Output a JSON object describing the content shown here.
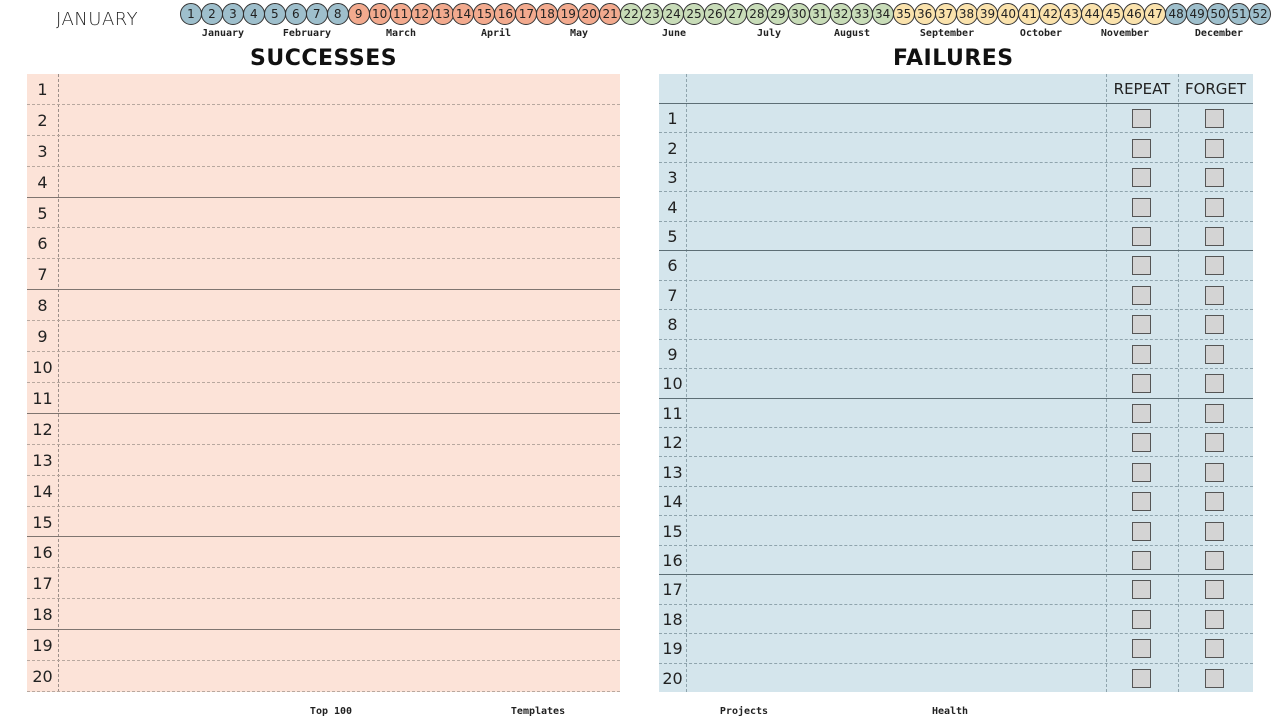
{
  "header": {
    "month_title": "JANUARY"
  },
  "weeks": [
    "1",
    "2",
    "3",
    "4",
    "5",
    "6",
    "7",
    "8",
    "9",
    "10",
    "11",
    "12",
    "13",
    "14",
    "15",
    "16",
    "17",
    "18",
    "19",
    "20",
    "21",
    "22",
    "23",
    "24",
    "25",
    "26",
    "27",
    "28",
    "29",
    "30",
    "31",
    "32",
    "33",
    "34",
    "35",
    "36",
    "37",
    "38",
    "39",
    "40",
    "41",
    "42",
    "43",
    "44",
    "45",
    "46",
    "47",
    "48",
    "49",
    "50",
    "51",
    "52"
  ],
  "week_season_colors": {
    "winter": "#9ebfcc",
    "spring": "#f2aa8e",
    "summer": "#c8dcb8",
    "autumn": "#fae2ac"
  },
  "week_seasons": [
    "winter",
    "winter",
    "winter",
    "winter",
    "winter",
    "winter",
    "winter",
    "winter",
    "spring",
    "spring",
    "spring",
    "spring",
    "spring",
    "spring",
    "spring",
    "spring",
    "spring",
    "spring",
    "spring",
    "spring",
    "spring",
    "summer",
    "summer",
    "summer",
    "summer",
    "summer",
    "summer",
    "summer",
    "summer",
    "summer",
    "summer",
    "summer",
    "summer",
    "summer",
    "autumn",
    "autumn",
    "autumn",
    "autumn",
    "autumn",
    "autumn",
    "autumn",
    "autumn",
    "autumn",
    "autumn",
    "autumn",
    "autumn",
    "autumn",
    "winter",
    "winter",
    "winter",
    "winter",
    "winter"
  ],
  "months": [
    "January",
    "February",
    "March",
    "April",
    "May",
    "June",
    "July",
    "August",
    "September",
    "October",
    "November",
    "December"
  ],
  "successes": {
    "title": "SUCCESSES",
    "rows": [
      "1",
      "2",
      "3",
      "4",
      "5",
      "6",
      "7",
      "8",
      "9",
      "10",
      "11",
      "12",
      "13",
      "14",
      "15",
      "16",
      "17",
      "18",
      "19",
      "20"
    ]
  },
  "failures": {
    "title": "FAILURES",
    "repeat_label": "REPEAT",
    "forget_label": "FORGET",
    "rows": [
      "1",
      "2",
      "3",
      "4",
      "5",
      "6",
      "7",
      "8",
      "9",
      "10",
      "11",
      "12",
      "13",
      "14",
      "15",
      "16",
      "17",
      "18",
      "19",
      "20"
    ]
  },
  "footer": {
    "links": [
      "Top 100",
      "Templates",
      "Projects",
      "Health"
    ]
  },
  "colors": {
    "successes_bg": "#fce3d8",
    "failures_bg": "#d4e5ec"
  }
}
